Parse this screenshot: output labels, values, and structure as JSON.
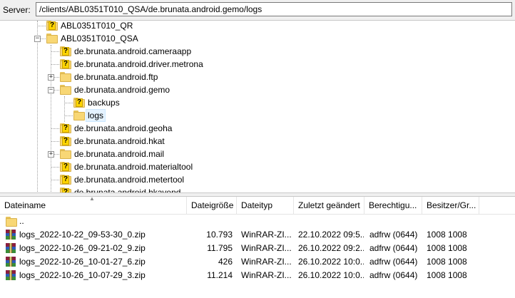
{
  "server": {
    "label": "Server:",
    "path": "/clients/ABL0351T010_QSA/de.brunata.android.gemo/logs"
  },
  "tree": {
    "nodes": [
      {
        "label": "ABL0351T010_QR",
        "unknown": true
      },
      {
        "label": "ABL0351T010_QSA",
        "unknown": false,
        "expander": "−"
      },
      {
        "label": "de.brunata.android.cameraapp",
        "unknown": true
      },
      {
        "label": "de.brunata.android.driver.metrona",
        "unknown": true
      },
      {
        "label": "de.brunata.android.ftp",
        "unknown": false,
        "expander": "+"
      },
      {
        "label": "de.brunata.android.gemo",
        "unknown": false,
        "expander": "−"
      },
      {
        "label": "backups",
        "unknown": true
      },
      {
        "label": "logs",
        "unknown": false,
        "selected": true
      },
      {
        "label": "de.brunata.android.geoha",
        "unknown": true
      },
      {
        "label": "de.brunata.android.hkat",
        "unknown": true
      },
      {
        "label": "de.brunata.android.mail",
        "unknown": false,
        "expander": "+"
      },
      {
        "label": "de.brunata.android.materialtool",
        "unknown": true
      },
      {
        "label": "de.brunata.android.metertool",
        "unknown": true
      },
      {
        "label": "de.brunata.android.hkavend",
        "unknown": true
      }
    ]
  },
  "filelist": {
    "columns": [
      "Dateiname",
      "Dateigröße",
      "Dateityp",
      "Zuletzt geändert",
      "Berechtigu...",
      "Besitzer/Gr..."
    ],
    "parent": "..",
    "rows": [
      {
        "name": "logs_2022-10-22_09-53-30_0.zip",
        "size": "10.793",
        "type": "WinRAR-ZI...",
        "modified": "22.10.2022 09:5...",
        "perms": "adfrw (0644)",
        "owner": "1008 1008"
      },
      {
        "name": "logs_2022-10-26_09-21-02_9.zip",
        "size": "11.795",
        "type": "WinRAR-ZI...",
        "modified": "26.10.2022 09:2...",
        "perms": "adfrw (0644)",
        "owner": "1008 1008"
      },
      {
        "name": "logs_2022-10-26_10-01-27_6.zip",
        "size": "426",
        "type": "WinRAR-ZI...",
        "modified": "26.10.2022 10:0...",
        "perms": "adfrw (0644)",
        "owner": "1008 1008"
      },
      {
        "name": "logs_2022-10-26_10-07-29_3.zip",
        "size": "11.214",
        "type": "WinRAR-ZI...",
        "modified": "26.10.2022 10:0...",
        "perms": "adfrw (0644)",
        "owner": "1008 1008"
      }
    ]
  },
  "colors": {
    "selection": "#e5f3ff",
    "folder": "#f8d775",
    "unknown_badge": "#ffd400"
  }
}
